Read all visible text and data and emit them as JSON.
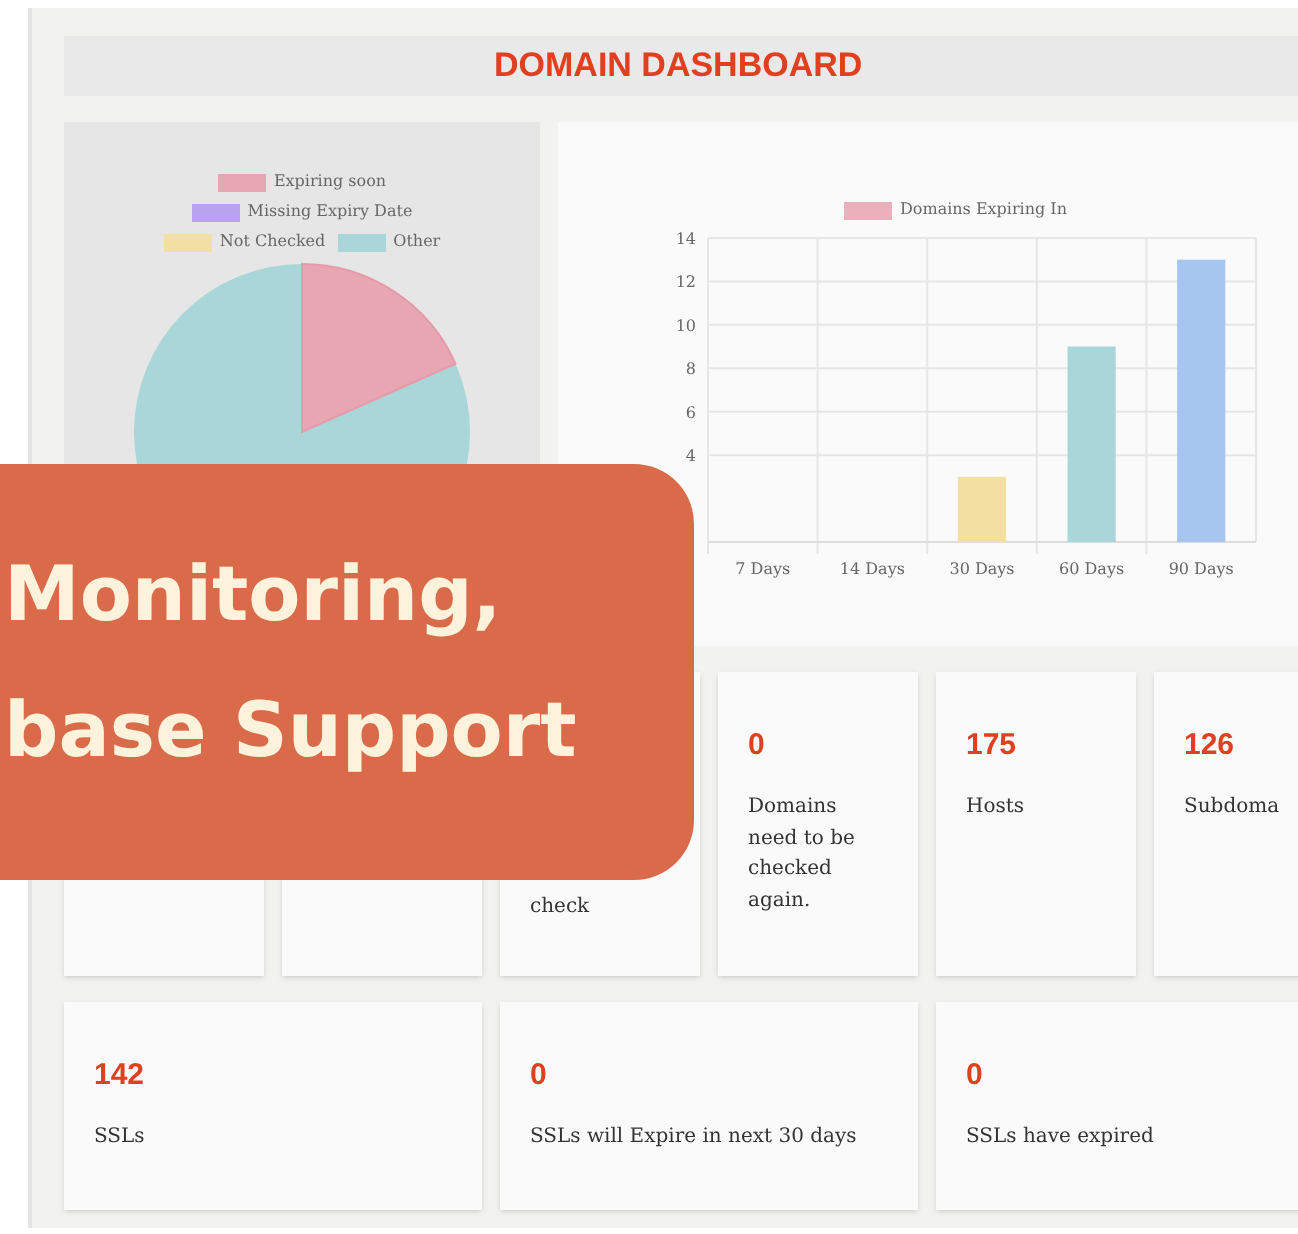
{
  "header": {
    "title": "DOMAIN DASHBOARD"
  },
  "pie_panel": {
    "legend": [
      {
        "label": "Expiring soon",
        "color": "#e8a6b2"
      },
      {
        "label": "Missing Expiry Date",
        "color": "#b9a3ee"
      },
      {
        "label": "Not Checked",
        "color": "#f3dfa2"
      },
      {
        "label": "Other",
        "color": "#a9d6d8"
      }
    ]
  },
  "bar_panel": {
    "chart_data": {
      "type": "bar",
      "series": [
        {
          "name": "Domains Expiring In",
          "values": [
            0,
            0,
            3,
            9,
            13
          ]
        }
      ],
      "categories": [
        "7 Days",
        "14 Days",
        "30 Days",
        "60 Days",
        "90 Days"
      ],
      "ylim": [
        0,
        14
      ],
      "yticks": [
        4,
        6,
        8,
        10,
        12,
        14
      ],
      "grid": true
    },
    "legend": {
      "color": "#eab0bb"
    },
    "bars": [
      {
        "color": "#f3dfa2"
      },
      {
        "color": "#a9d6d8"
      },
      {
        "color": "#a7c6ef"
      }
    ]
  },
  "cards_row_1": [
    {
      "kind": "covered"
    },
    {
      "kind": "covered"
    },
    {
      "kind": "covered",
      "label": "check"
    },
    {
      "kind": "stat",
      "value": "0",
      "label": "Domains need to be checked again."
    },
    {
      "kind": "stat",
      "value": "175",
      "label": "Hosts"
    },
    {
      "kind": "stat",
      "value": "126",
      "label": "Subdoma"
    }
  ],
  "cards_row_2": [
    {
      "value": "142",
      "label": "SSLs"
    },
    {
      "value": "0",
      "label": "SSLs will Expire in next 30 days"
    },
    {
      "value": "0",
      "label": "SSLs have expired"
    }
  ],
  "banner": {
    "lines": [
      "Monitoring,",
      "base Support"
    ]
  }
}
